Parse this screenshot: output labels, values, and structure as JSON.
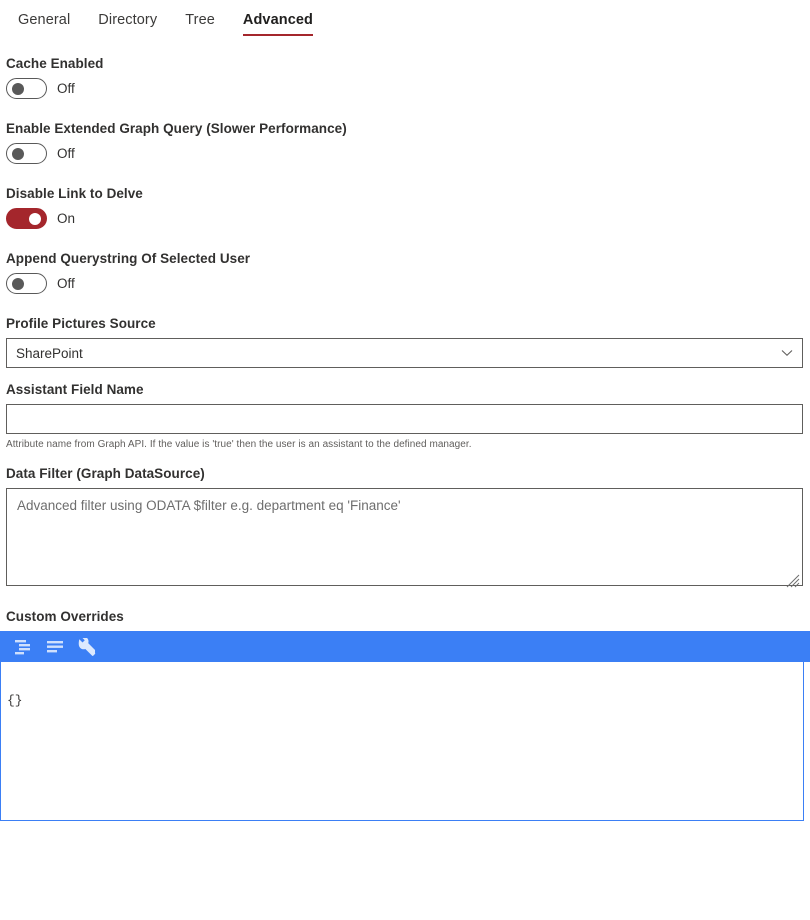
{
  "theme": {
    "accent": "#a4262c",
    "editor_toolbar": "#3b7ff5",
    "editor_border": "#3b7ff5"
  },
  "tabs": [
    {
      "label": "General",
      "active": false
    },
    {
      "label": "Directory",
      "active": false
    },
    {
      "label": "Tree",
      "active": false
    },
    {
      "label": "Advanced",
      "active": true
    }
  ],
  "toggles": [
    {
      "label": "Cache Enabled",
      "state_text": "Off",
      "on": false
    },
    {
      "label": "Enable Extended Graph Query (Slower Performance)",
      "state_text": "Off",
      "on": false
    },
    {
      "label": "Disable Link to Delve",
      "state_text": "On",
      "on": true
    },
    {
      "label": "Append Querystring Of Selected User",
      "state_text": "Off",
      "on": false
    }
  ],
  "profile_pictures_source": {
    "label": "Profile Pictures Source",
    "value": "SharePoint",
    "icon": "chevron-down-icon"
  },
  "assistant_field": {
    "label": "Assistant Field Name",
    "value": "",
    "placeholder": "",
    "helper": "Attribute name from Graph API. If the value is 'true' then the user is an assistant to the defined manager."
  },
  "data_filter": {
    "label": "Data Filter (Graph DataSource)",
    "value": "",
    "placeholder": "Advanced filter using ODATA $filter e.g. department eq 'Finance'"
  },
  "custom_overrides": {
    "label": "Custom Overrides",
    "toolbar_buttons": [
      {
        "icon": "format-indent-icon",
        "title": "Format"
      },
      {
        "icon": "align-left-icon",
        "title": "Compact"
      },
      {
        "icon": "wrench-icon",
        "title": "Settings"
      }
    ],
    "code": "{}"
  }
}
